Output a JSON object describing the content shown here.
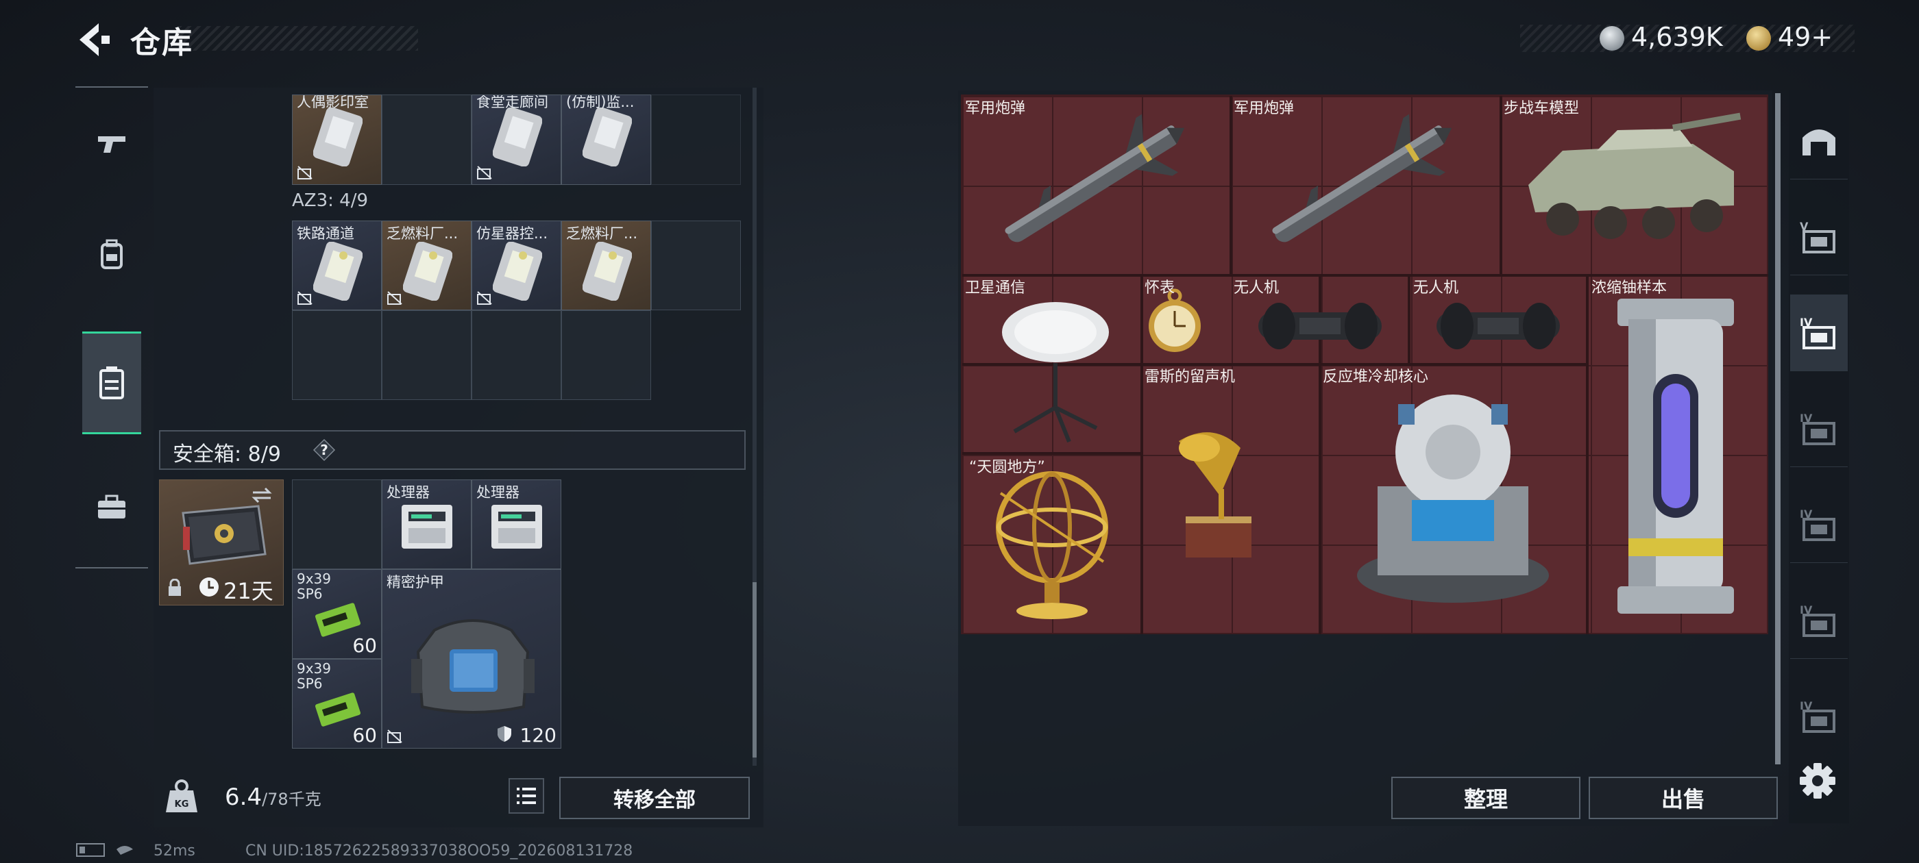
{
  "header": {
    "title": "仓库",
    "silver": "4,639K",
    "gold": "49+"
  },
  "left_nav": [
    "gun-icon",
    "backpack-icon",
    "rig-icon",
    "case-icon"
  ],
  "containers": {
    "top_items": [
      {
        "name": "人偶影印室"
      },
      {
        "name": "食堂走廊间"
      },
      {
        "name": "(仿制)监..."
      }
    ],
    "az3_label": "AZ3: 4/9",
    "az3_items": [
      {
        "name": "铁路通道"
      },
      {
        "name": "乏燃料厂..."
      },
      {
        "name": "仿星器控..."
      },
      {
        "name": "乏燃料厂..."
      }
    ]
  },
  "safe": {
    "label": "安全箱: 8/9",
    "help": "?",
    "days": "21天",
    "items": [
      {
        "name": "处理器"
      },
      {
        "name": "处理器"
      },
      {
        "name": "9x39 SP6",
        "qty": "60"
      },
      {
        "name": "精密护甲",
        "qty": "120"
      },
      {
        "name": "9x39 SP6",
        "qty": "60"
      }
    ]
  },
  "bottom_left": {
    "weight": "6.4",
    "weight_max": "/78千克",
    "transfer_all": "转移全部"
  },
  "stash": {
    "items": [
      {
        "name": "军用炮弹"
      },
      {
        "name": "军用炮弹"
      },
      {
        "name": "步战车模型"
      },
      {
        "name": "卫星通信"
      },
      {
        "name": "怀表"
      },
      {
        "name": "无人机"
      },
      {
        "name": "无人机"
      },
      {
        "name": "浓缩铀样本"
      },
      {
        "name": "雷斯的留声机"
      },
      {
        "name": "反应堆冷却核心"
      },
      {
        "name": "“天圆地方”"
      }
    ],
    "sort": "整理",
    "sell": "出售"
  },
  "right_nav": [
    "home-icon",
    "V",
    "IV",
    "IV",
    "IV",
    "IV",
    "IV"
  ],
  "status": {
    "ping": "52ms",
    "uid": "CN UID:18572622589337038OO59_202608131728"
  },
  "colors": {
    "accent": "#34d69b",
    "stash_bg": "#5b2a2f",
    "panel_bg": "#181e26"
  }
}
